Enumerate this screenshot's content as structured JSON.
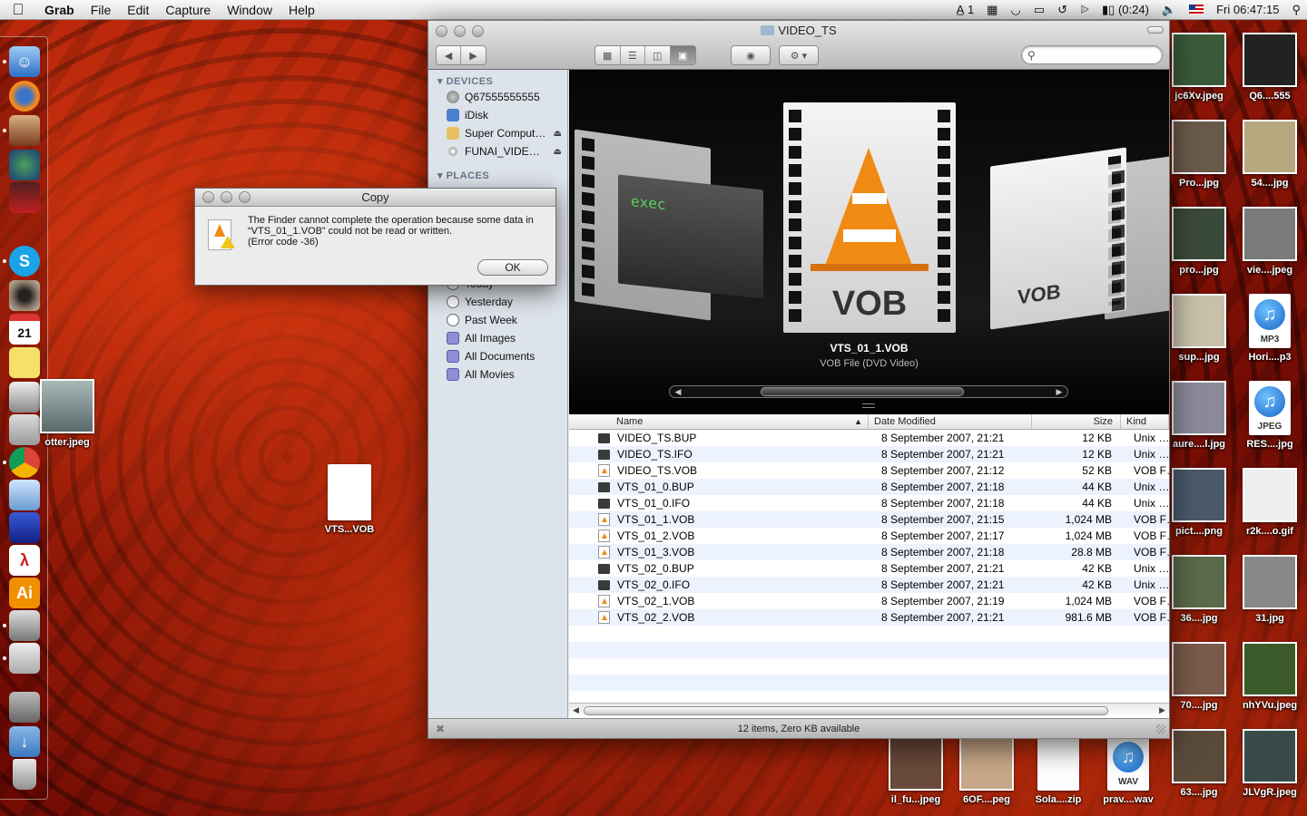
{
  "menubar": {
    "app_name": "Grab",
    "menus": [
      "File",
      "Edit",
      "Capture",
      "Window",
      "Help"
    ],
    "status": {
      "input_badge": "1",
      "battery_text": "(0:24)",
      "clock": "Fri 06:47:15"
    }
  },
  "finder": {
    "title": "VIDEO_TS",
    "search_placeholder": "",
    "sidebar": {
      "devices_heading": "DEVICES",
      "devices": [
        {
          "label": "Q67555555555",
          "icon": "harddisk-icon",
          "eject": false
        },
        {
          "label": "iDisk",
          "icon": "idisk-icon",
          "eject": false
        },
        {
          "label": "Super Comput…",
          "icon": "computer-icon",
          "eject": true
        },
        {
          "label": "FUNAI_VIDEO_…",
          "icon": "dvd-icon",
          "eject": true
        }
      ],
      "places_heading": "PLACES",
      "search_items": [
        {
          "label": "Today",
          "icon": "clock-icon"
        },
        {
          "label": "Yesterday",
          "icon": "clock-icon"
        },
        {
          "label": "Past Week",
          "icon": "clock-icon"
        },
        {
          "label": "All Images",
          "icon": "smart-folder-icon"
        },
        {
          "label": "All Documents",
          "icon": "smart-folder-icon"
        },
        {
          "label": "All Movies",
          "icon": "smart-folder-icon"
        }
      ]
    },
    "coverflow": {
      "selected_name": "VTS_01_1.VOB",
      "selected_kind": "VOB File (DVD Video)",
      "side_label_left": "exec",
      "big_label": "VOB"
    },
    "columns": {
      "name": "Name",
      "date": "Date Modified",
      "size": "Size",
      "kind": "Kind"
    },
    "files": [
      {
        "name": "VIDEO_TS.BUP",
        "date": "8 September 2007, 21:21",
        "size": "12 KB",
        "kind": "Unix …",
        "type": "exec"
      },
      {
        "name": "VIDEO_TS.IFO",
        "date": "8 September 2007, 21:21",
        "size": "12 KB",
        "kind": "Unix …",
        "type": "exec"
      },
      {
        "name": "VIDEO_TS.VOB",
        "date": "8 September 2007, 21:12",
        "size": "52 KB",
        "kind": "VOB F…",
        "type": "vob"
      },
      {
        "name": "VTS_01_0.BUP",
        "date": "8 September 2007, 21:18",
        "size": "44 KB",
        "kind": "Unix …",
        "type": "exec"
      },
      {
        "name": "VTS_01_0.IFO",
        "date": "8 September 2007, 21:18",
        "size": "44 KB",
        "kind": "Unix …",
        "type": "exec"
      },
      {
        "name": "VTS_01_1.VOB",
        "date": "8 September 2007, 21:15",
        "size": "1,024 MB",
        "kind": "VOB F…",
        "type": "vob"
      },
      {
        "name": "VTS_01_2.VOB",
        "date": "8 September 2007, 21:17",
        "size": "1,024 MB",
        "kind": "VOB F…",
        "type": "vob"
      },
      {
        "name": "VTS_01_3.VOB",
        "date": "8 September 2007, 21:18",
        "size": "28.8 MB",
        "kind": "VOB F…",
        "type": "vob"
      },
      {
        "name": "VTS_02_0.BUP",
        "date": "8 September 2007, 21:21",
        "size": "42 KB",
        "kind": "Unix …",
        "type": "exec"
      },
      {
        "name": "VTS_02_0.IFO",
        "date": "8 September 2007, 21:21",
        "size": "42 KB",
        "kind": "Unix …",
        "type": "exec"
      },
      {
        "name": "VTS_02_1.VOB",
        "date": "8 September 2007, 21:19",
        "size": "1,024 MB",
        "kind": "VOB F…",
        "type": "vob"
      },
      {
        "name": "VTS_02_2.VOB",
        "date": "8 September 2007, 21:21",
        "size": "981.6 MB",
        "kind": "VOB F…",
        "type": "vob"
      }
    ],
    "status_text": "12 items, Zero KB available"
  },
  "dialog": {
    "title": "Copy",
    "message": "The Finder cannot complete the operation because some data in “VTS_01_1.VOB” could not be read or written.",
    "error_code": "(Error code -36)",
    "ok_label": "OK"
  },
  "desktop": {
    "left_icons": [
      {
        "label": "otter.jpeg"
      },
      {
        "label": "VTS...VOB"
      }
    ],
    "right_icons": [
      {
        "label": "jc6Xv.jpeg"
      },
      {
        "label": "Q6....555"
      },
      {
        "label": "Pro...jpg"
      },
      {
        "label": "54....jpg"
      },
      {
        "label": "pro...jpg"
      },
      {
        "label": "vie....jpeg"
      },
      {
        "label": "sup...jpg"
      },
      {
        "label": "Hori....p3",
        "badge": "MP3"
      },
      {
        "label": "aure....l.jpg"
      },
      {
        "label": "RES....jpg",
        "badge": "JPEG"
      },
      {
        "label": "pict....png"
      },
      {
        "label": "r2k....o.gif"
      },
      {
        "label": "36....jpg"
      },
      {
        "label": "31.jpg"
      },
      {
        "label": "70....jpg"
      },
      {
        "label": "nhYVu.jpeg"
      },
      {
        "label": "63....jpg"
      },
      {
        "label": "JLVgR.jpeg"
      }
    ],
    "bottom_icons": [
      {
        "label": "il_fu...jpeg"
      },
      {
        "label": "6OF....peg"
      },
      {
        "label": "Sola....zip"
      },
      {
        "label": "prav....wav",
        "badge": "WAV"
      }
    ]
  },
  "dock": {
    "items": [
      "finder-icon",
      "firefox-icon",
      "app-icon",
      "globe-icon",
      "portrait-icon",
      "skype-icon",
      "eye-icon",
      "calendar-icon",
      "stickies-icon",
      "printer-icon",
      "scanner-icon",
      "chrome-icon",
      "preview-icon",
      "spaces-icon",
      "acrobat-icon",
      "illustrator-icon",
      "disk-icon",
      "utility-icon",
      "drive-icon",
      "downloads-icon",
      "trash-icon"
    ],
    "calendar_day": "21",
    "illustrator_label": "Ai"
  },
  "colors": {
    "accent_select": "#1a63c7",
    "alt_row": "#edf3fe",
    "cone_orange": "#f08a12",
    "wallpaper_red": "#b8250a"
  }
}
